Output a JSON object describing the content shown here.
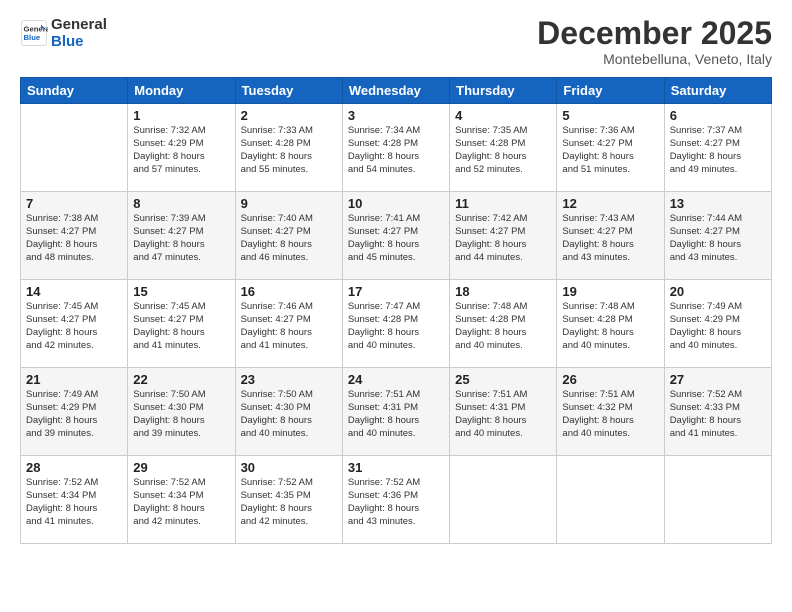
{
  "header": {
    "logo_line1": "General",
    "logo_line2": "Blue",
    "month": "December 2025",
    "location": "Montebelluna, Veneto, Italy"
  },
  "days_of_week": [
    "Sunday",
    "Monday",
    "Tuesday",
    "Wednesday",
    "Thursday",
    "Friday",
    "Saturday"
  ],
  "weeks": [
    [
      {
        "day": "",
        "info": ""
      },
      {
        "day": "1",
        "info": "Sunrise: 7:32 AM\nSunset: 4:29 PM\nDaylight: 8 hours\nand 57 minutes."
      },
      {
        "day": "2",
        "info": "Sunrise: 7:33 AM\nSunset: 4:28 PM\nDaylight: 8 hours\nand 55 minutes."
      },
      {
        "day": "3",
        "info": "Sunrise: 7:34 AM\nSunset: 4:28 PM\nDaylight: 8 hours\nand 54 minutes."
      },
      {
        "day": "4",
        "info": "Sunrise: 7:35 AM\nSunset: 4:28 PM\nDaylight: 8 hours\nand 52 minutes."
      },
      {
        "day": "5",
        "info": "Sunrise: 7:36 AM\nSunset: 4:27 PM\nDaylight: 8 hours\nand 51 minutes."
      },
      {
        "day": "6",
        "info": "Sunrise: 7:37 AM\nSunset: 4:27 PM\nDaylight: 8 hours\nand 49 minutes."
      }
    ],
    [
      {
        "day": "7",
        "info": "Sunrise: 7:38 AM\nSunset: 4:27 PM\nDaylight: 8 hours\nand 48 minutes."
      },
      {
        "day": "8",
        "info": "Sunrise: 7:39 AM\nSunset: 4:27 PM\nDaylight: 8 hours\nand 47 minutes."
      },
      {
        "day": "9",
        "info": "Sunrise: 7:40 AM\nSunset: 4:27 PM\nDaylight: 8 hours\nand 46 minutes."
      },
      {
        "day": "10",
        "info": "Sunrise: 7:41 AM\nSunset: 4:27 PM\nDaylight: 8 hours\nand 45 minutes."
      },
      {
        "day": "11",
        "info": "Sunrise: 7:42 AM\nSunset: 4:27 PM\nDaylight: 8 hours\nand 44 minutes."
      },
      {
        "day": "12",
        "info": "Sunrise: 7:43 AM\nSunset: 4:27 PM\nDaylight: 8 hours\nand 43 minutes."
      },
      {
        "day": "13",
        "info": "Sunrise: 7:44 AM\nSunset: 4:27 PM\nDaylight: 8 hours\nand 43 minutes."
      }
    ],
    [
      {
        "day": "14",
        "info": "Sunrise: 7:45 AM\nSunset: 4:27 PM\nDaylight: 8 hours\nand 42 minutes."
      },
      {
        "day": "15",
        "info": "Sunrise: 7:45 AM\nSunset: 4:27 PM\nDaylight: 8 hours\nand 41 minutes."
      },
      {
        "day": "16",
        "info": "Sunrise: 7:46 AM\nSunset: 4:27 PM\nDaylight: 8 hours\nand 41 minutes."
      },
      {
        "day": "17",
        "info": "Sunrise: 7:47 AM\nSunset: 4:28 PM\nDaylight: 8 hours\nand 40 minutes."
      },
      {
        "day": "18",
        "info": "Sunrise: 7:48 AM\nSunset: 4:28 PM\nDaylight: 8 hours\nand 40 minutes."
      },
      {
        "day": "19",
        "info": "Sunrise: 7:48 AM\nSunset: 4:28 PM\nDaylight: 8 hours\nand 40 minutes."
      },
      {
        "day": "20",
        "info": "Sunrise: 7:49 AM\nSunset: 4:29 PM\nDaylight: 8 hours\nand 40 minutes."
      }
    ],
    [
      {
        "day": "21",
        "info": "Sunrise: 7:49 AM\nSunset: 4:29 PM\nDaylight: 8 hours\nand 39 minutes."
      },
      {
        "day": "22",
        "info": "Sunrise: 7:50 AM\nSunset: 4:30 PM\nDaylight: 8 hours\nand 39 minutes."
      },
      {
        "day": "23",
        "info": "Sunrise: 7:50 AM\nSunset: 4:30 PM\nDaylight: 8 hours\nand 40 minutes."
      },
      {
        "day": "24",
        "info": "Sunrise: 7:51 AM\nSunset: 4:31 PM\nDaylight: 8 hours\nand 40 minutes."
      },
      {
        "day": "25",
        "info": "Sunrise: 7:51 AM\nSunset: 4:31 PM\nDaylight: 8 hours\nand 40 minutes."
      },
      {
        "day": "26",
        "info": "Sunrise: 7:51 AM\nSunset: 4:32 PM\nDaylight: 8 hours\nand 40 minutes."
      },
      {
        "day": "27",
        "info": "Sunrise: 7:52 AM\nSunset: 4:33 PM\nDaylight: 8 hours\nand 41 minutes."
      }
    ],
    [
      {
        "day": "28",
        "info": "Sunrise: 7:52 AM\nSunset: 4:34 PM\nDaylight: 8 hours\nand 41 minutes."
      },
      {
        "day": "29",
        "info": "Sunrise: 7:52 AM\nSunset: 4:34 PM\nDaylight: 8 hours\nand 42 minutes."
      },
      {
        "day": "30",
        "info": "Sunrise: 7:52 AM\nSunset: 4:35 PM\nDaylight: 8 hours\nand 42 minutes."
      },
      {
        "day": "31",
        "info": "Sunrise: 7:52 AM\nSunset: 4:36 PM\nDaylight: 8 hours\nand 43 minutes."
      },
      {
        "day": "",
        "info": ""
      },
      {
        "day": "",
        "info": ""
      },
      {
        "day": "",
        "info": ""
      }
    ]
  ]
}
